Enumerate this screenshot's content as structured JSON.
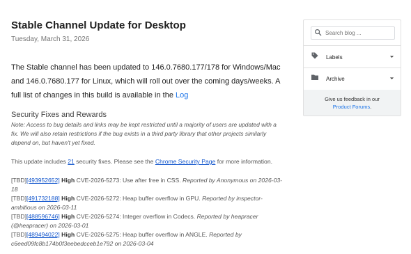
{
  "post": {
    "title": "Stable Channel Update for Desktop",
    "date": "Tuesday, March 31, 2026",
    "intro": "The Stable channel has been updated to 146.0.7680.177/178 for Windows/Mac and 146.0.7680.177 for Linux, which will roll out over the coming days/weeks. A full list of changes in this build is available in the",
    "log_link": "Log",
    "security_heading": "Security Fixes and Rewards",
    "note": "Note: Access to bug details and links may be kept restricted until a majority of users are updated with a fix. We will also retain restrictions if the bug exists in a third party library that other projects similarly depend on, but haven't yet fixed.",
    "update_prefix": "This update includes",
    "fix_count": "21",
    "update_middle": "security fixes. Please see the",
    "security_page_link": "Chrome Security Page",
    "update_suffix": "for more information.",
    "fixes": [
      {
        "tbd": "[TBD]",
        "id": "[493952652]",
        "severity": "High",
        "desc": "CVE-2026-5273: Use after free in CSS.",
        "report": "Reported by Anonymous on 2026-03-18"
      },
      {
        "tbd": "[TBD]",
        "id": "[491732188]",
        "severity": "High",
        "desc": "CVE-2026-5272: Heap buffer overflow in GPU.",
        "report": "Reported by inspector-ambitious on 2026-03-11"
      },
      {
        "tbd": "[TBD]",
        "id": "[488596746]",
        "severity": "High",
        "desc": "CVE-2026-5274: Integer overflow in Codecs.",
        "report": "Reported by heapracer (@heapracer) on 2026-03-01"
      },
      {
        "tbd": "[TBD]",
        "id": "[489494022]",
        "severity": "High",
        "desc": "CVE-2026-5275: Heap buffer overflow in ANGLE.",
        "report": "Reported by c6eed09fc8b174b0f3eebedcceb1e792 on 2026-03-04"
      }
    ]
  },
  "sidebar": {
    "search_placeholder": "Search blog ...",
    "labels": "Labels",
    "archive": "Archive",
    "feedback_text": "Give us feedback in our",
    "feedback_link": "Product Forums"
  },
  "icons": [
    "search-icon",
    "label-tag-icon",
    "folder-icon",
    "chevron-down-icon"
  ],
  "colors": {
    "link": "#1a73e8",
    "text": "#212121",
    "muted": "#757575"
  }
}
